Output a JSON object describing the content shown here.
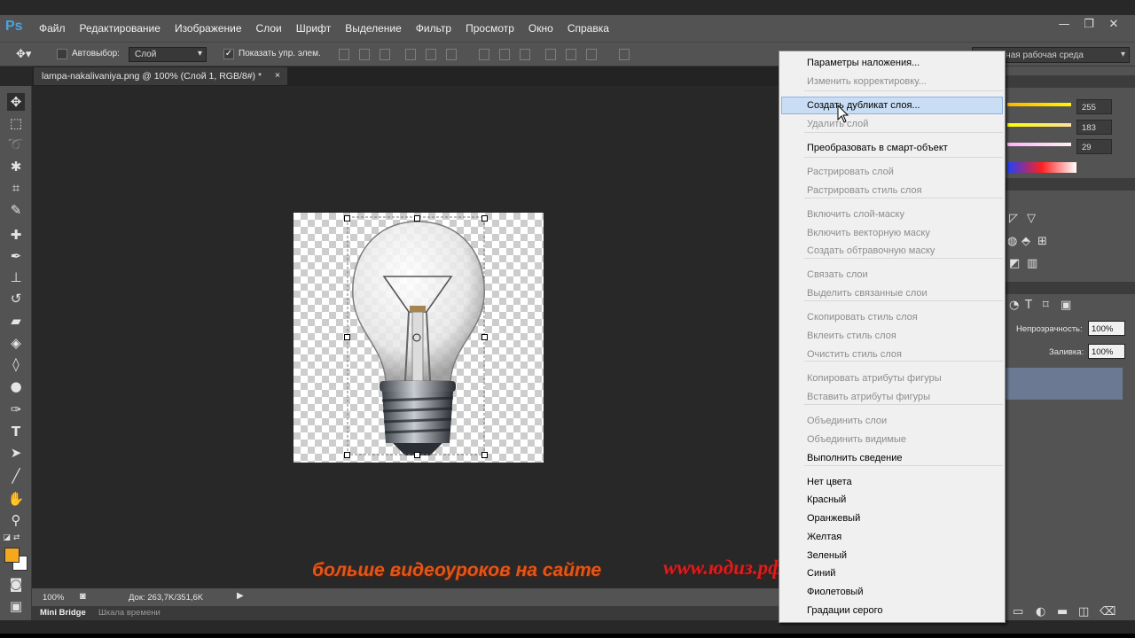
{
  "menubar": {
    "logo": "Ps",
    "items": [
      "Файл",
      "Редактирование",
      "Изображение",
      "Слои",
      "Шрифт",
      "Выделение",
      "Фильтр",
      "Просмотр",
      "Окно",
      "Справка"
    ],
    "win": [
      "—",
      "❐",
      "✕"
    ]
  },
  "options": {
    "autoselect": "Автовыбор:",
    "layer": "Слой",
    "show_controls": "Показать упр. элем.",
    "workspace": "Основная рабочая среда"
  },
  "doc_tab": "lampa-nakalivaniya.png @ 100% (Слой 1, RGB/8#) *",
  "status": {
    "zoom": "100%",
    "doc": "Док: 263,7K/351,6K"
  },
  "bottom_tabs": [
    "Mini Bridge",
    "Шкала времени"
  ],
  "watermark": {
    "text": "больше видеоуроков на сайте",
    "site": "www.юдиз.рф"
  },
  "color_panel": {
    "values": [
      "255",
      "183",
      "29"
    ]
  },
  "layers_panel": {
    "opacity_label": "Непрозрачность:",
    "opacity": "100%",
    "fill_label": "Заливка:",
    "fill": "100%"
  },
  "colors": {
    "foreground": "#f6a81c",
    "background": "#ffffff",
    "highlight": "#c9def5"
  },
  "context_menu": [
    {
      "label": "Параметры наложения...",
      "disabled": false
    },
    {
      "label": "Изменить корректировку...",
      "disabled": true
    },
    {
      "label": "Создать дубликат слоя...",
      "disabled": false,
      "highlighted": true
    },
    {
      "label": "Удалить слой",
      "disabled": true
    },
    {
      "label": "Преобразовать в смарт-объект",
      "disabled": false
    },
    {
      "label": "Растрировать слой",
      "disabled": true
    },
    {
      "label": "Растрировать стиль слоя",
      "disabled": true
    },
    {
      "label": "Включить слой-маску",
      "disabled": true
    },
    {
      "label": "Включить векторную маску",
      "disabled": true
    },
    {
      "label": "Создать обтравочную маску",
      "disabled": true
    },
    {
      "label": "Связать слои",
      "disabled": true
    },
    {
      "label": "Выделить связанные слои",
      "disabled": true
    },
    {
      "label": "Скопировать стиль слоя",
      "disabled": true
    },
    {
      "label": "Вклеить стиль слоя",
      "disabled": true
    },
    {
      "label": "Очистить стиль слоя",
      "disabled": true
    },
    {
      "label": "Копировать атрибуты фигуры",
      "disabled": true
    },
    {
      "label": "Вставить атрибуты фигуры",
      "disabled": true
    },
    {
      "label": "Объединить слои",
      "disabled": true
    },
    {
      "label": "Объединить видимые",
      "disabled": true
    },
    {
      "label": "Выполнить сведение",
      "disabled": false
    },
    {
      "label": "Нет цвета",
      "disabled": false
    },
    {
      "label": "Красный",
      "disabled": false
    },
    {
      "label": "Оранжевый",
      "disabled": false
    },
    {
      "label": "Желтая",
      "disabled": false
    },
    {
      "label": "Зеленый",
      "disabled": false
    },
    {
      "label": "Синий",
      "disabled": false
    },
    {
      "label": "Фиолетовый",
      "disabled": false
    },
    {
      "label": "Градации серого",
      "disabled": false
    }
  ]
}
